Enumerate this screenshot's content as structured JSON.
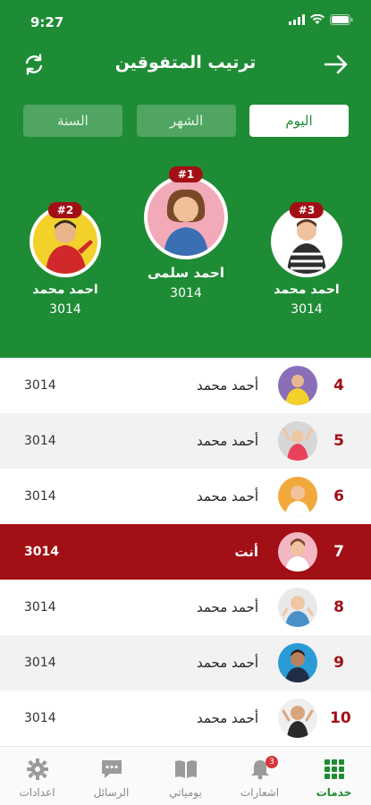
{
  "status": {
    "time": "9:27"
  },
  "header": {
    "title": "ترتيب المتفوقين"
  },
  "tabs": [
    {
      "label": "اليوم",
      "active": true
    },
    {
      "label": "الشهر",
      "active": false
    },
    {
      "label": "السنة",
      "active": false
    }
  ],
  "podium": {
    "first": {
      "badge": "#1",
      "name": "احمد سلمى",
      "score": "3014"
    },
    "second": {
      "badge": "#2",
      "name": "احمد محمد",
      "score": "3014"
    },
    "third": {
      "badge": "#3",
      "name": "احمد محمد",
      "score": "3014"
    }
  },
  "ranking": [
    {
      "rank": "4",
      "name": "أحمد محمد",
      "score": "3014",
      "avatar_color": "#8a6fb8"
    },
    {
      "rank": "5",
      "name": "أحمد محمد",
      "score": "3014",
      "avatar_color": "#d7d7d7"
    },
    {
      "rank": "6",
      "name": "أحمد محمد",
      "score": "3014",
      "avatar_color": "#f2a93b"
    },
    {
      "rank": "7",
      "name": "أنت",
      "score": "3014",
      "avatar_color": "#f3b7c4",
      "is_me": true
    },
    {
      "rank": "8",
      "name": "أحمد محمد",
      "score": "3014",
      "avatar_color": "#e9e9e9"
    },
    {
      "rank": "9",
      "name": "أحمد محمد",
      "score": "3014",
      "avatar_color": "#2a9bd6"
    },
    {
      "rank": "10",
      "name": "أحمد محمد",
      "score": "3014",
      "avatar_color": "#efefef"
    }
  ],
  "nav": [
    {
      "label": "خدمات",
      "icon": "grid-icon",
      "active": true
    },
    {
      "label": "اشعارات",
      "icon": "bell-icon",
      "badge": "3"
    },
    {
      "label": "يومياتي",
      "icon": "book-icon"
    },
    {
      "label": "الرسائل",
      "icon": "chat-icon"
    },
    {
      "label": "اعدادات",
      "icon": "gear-icon"
    }
  ],
  "colors": {
    "primary_green": "#1e8c35",
    "accent_red": "#a20f14"
  }
}
